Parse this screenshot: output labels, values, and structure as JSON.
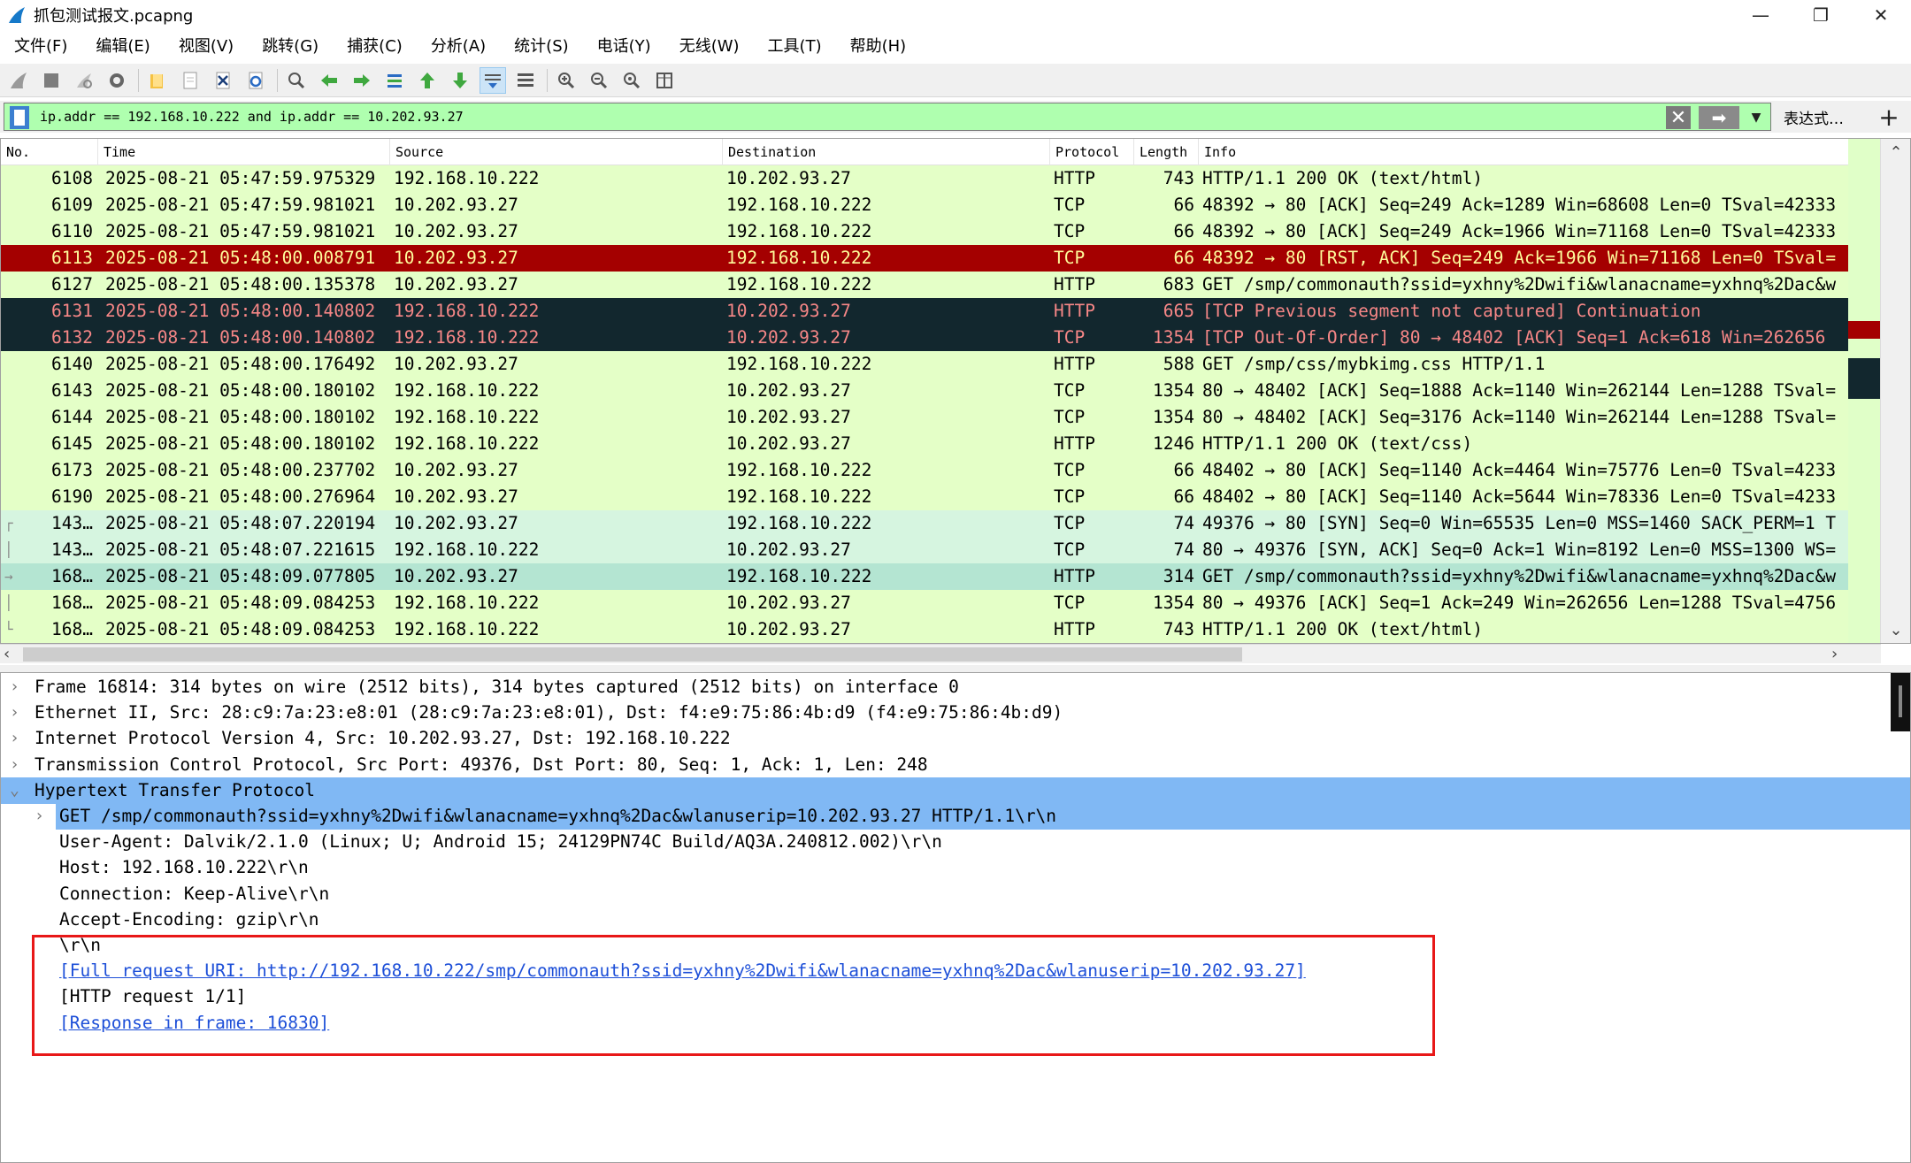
{
  "window": {
    "title": "抓包测试报文.pcapng",
    "min": "—",
    "restore": "❐",
    "close": "✕"
  },
  "menu": [
    "文件(F)",
    "编辑(E)",
    "视图(V)",
    "跳转(G)",
    "捕获(C)",
    "分析(A)",
    "统计(S)",
    "电话(Y)",
    "无线(W)",
    "工具(T)",
    "帮助(H)"
  ],
  "toolbar": {
    "icons": [
      "shark-fin-start-icon",
      "stop-icon",
      "restart-icon",
      "options-gear-icon",
      "open-folder-icon",
      "file-icon",
      "close-file-icon",
      "reload-icon",
      "find-icon",
      "back-arrow-icon",
      "forward-arrow-icon",
      "goto-packet-icon",
      "first-packet-icon",
      "last-packet-icon",
      "autoscroll-icon",
      "colorize-icon",
      "zoom-in-icon",
      "zoom-out-icon",
      "normal-size-icon",
      "resize-columns-icon"
    ]
  },
  "filter": {
    "value": "ip.addr == 192.168.10.222 and ip.addr == 10.202.93.27",
    "clear": "✕",
    "apply": "➡",
    "dropdown": "▼",
    "expression_label": "表达式…",
    "add": "+"
  },
  "packet_list": {
    "columns": [
      "No.",
      "Time",
      "Source",
      "Destination",
      "Protocol",
      "Length",
      "Info"
    ],
    "rows": [
      {
        "no": "6108",
        "time": "2025-08-21 05:47:59.975329",
        "src": "192.168.10.222",
        "dst": "10.202.93.27",
        "proto": "HTTP",
        "len": "743",
        "info": "HTTP/1.1 200 OK  (text/html)",
        "style": "normal",
        "mark": ""
      },
      {
        "no": "6109",
        "time": "2025-08-21 05:47:59.981021",
        "src": "10.202.93.27",
        "dst": "192.168.10.222",
        "proto": "TCP",
        "len": "66",
        "info": "48392 → 80 [ACK] Seq=249 Ack=1289 Win=68608 Len=0 TSval=42333",
        "style": "normal",
        "mark": ""
      },
      {
        "no": "6110",
        "time": "2025-08-21 05:47:59.981021",
        "src": "10.202.93.27",
        "dst": "192.168.10.222",
        "proto": "TCP",
        "len": "66",
        "info": "48392 → 80 [ACK] Seq=249 Ack=1966 Win=71168 Len=0 TSval=42333",
        "style": "normal",
        "mark": ""
      },
      {
        "no": "6113",
        "time": "2025-08-21 05:48:00.008791",
        "src": "10.202.93.27",
        "dst": "192.168.10.222",
        "proto": "TCP",
        "len": "66",
        "info": "48392 → 80 [RST, ACK] Seq=249 Ack=1966 Win=71168 Len=0 TSval=",
        "style": "rst",
        "mark": ""
      },
      {
        "no": "6127",
        "time": "2025-08-21 05:48:00.135378",
        "src": "10.202.93.27",
        "dst": "192.168.10.222",
        "proto": "HTTP",
        "len": "683",
        "info": "GET /smp/commonauth?ssid=yxhny%2Dwifi&wlanacname=yxhnq%2Dac&w",
        "style": "normal",
        "mark": ""
      },
      {
        "no": "6131",
        "time": "2025-08-21 05:48:00.140802",
        "src": "192.168.10.222",
        "dst": "10.202.93.27",
        "proto": "HTTP",
        "len": "665",
        "info": "[TCP Previous segment not captured] Continuation",
        "style": "bad",
        "mark": ""
      },
      {
        "no": "6132",
        "time": "2025-08-21 05:48:00.140802",
        "src": "192.168.10.222",
        "dst": "10.202.93.27",
        "proto": "TCP",
        "len": "1354",
        "info": "[TCP Out-Of-Order] 80 → 48402 [ACK] Seq=1 Ack=618 Win=262656",
        "style": "bad",
        "mark": ""
      },
      {
        "no": "6140",
        "time": "2025-08-21 05:48:00.176492",
        "src": "10.202.93.27",
        "dst": "192.168.10.222",
        "proto": "HTTP",
        "len": "588",
        "info": "GET /smp/css/mybkimg.css HTTP/1.1",
        "style": "normal",
        "mark": ""
      },
      {
        "no": "6143",
        "time": "2025-08-21 05:48:00.180102",
        "src": "192.168.10.222",
        "dst": "10.202.93.27",
        "proto": "TCP",
        "len": "1354",
        "info": "80 → 48402 [ACK] Seq=1888 Ack=1140 Win=262144 Len=1288 TSval=",
        "style": "normal",
        "mark": ""
      },
      {
        "no": "6144",
        "time": "2025-08-21 05:48:00.180102",
        "src": "192.168.10.222",
        "dst": "10.202.93.27",
        "proto": "TCP",
        "len": "1354",
        "info": "80 → 48402 [ACK] Seq=3176 Ack=1140 Win=262144 Len=1288 TSval=",
        "style": "normal",
        "mark": ""
      },
      {
        "no": "6145",
        "time": "2025-08-21 05:48:00.180102",
        "src": "192.168.10.222",
        "dst": "10.202.93.27",
        "proto": "HTTP",
        "len": "1246",
        "info": "HTTP/1.1 200 OK  (text/css)",
        "style": "normal",
        "mark": ""
      },
      {
        "no": "6173",
        "time": "2025-08-21 05:48:00.237702",
        "src": "10.202.93.27",
        "dst": "192.168.10.222",
        "proto": "TCP",
        "len": "66",
        "info": "48402 → 80 [ACK] Seq=1140 Ack=4464 Win=75776 Len=0 TSval=4233",
        "style": "normal",
        "mark": ""
      },
      {
        "no": "6190",
        "time": "2025-08-21 05:48:00.276964",
        "src": "10.202.93.27",
        "dst": "192.168.10.222",
        "proto": "TCP",
        "len": "66",
        "info": "48402 → 80 [ACK] Seq=1140 Ack=5644 Win=78336 Len=0 TSval=4233",
        "style": "normal",
        "mark": ""
      },
      {
        "no": "143…",
        "time": "2025-08-21 05:48:07.220194",
        "src": "10.202.93.27",
        "dst": "192.168.10.222",
        "proto": "TCP",
        "len": "74",
        "info": "49376 → 80 [SYN] Seq=0 Win=65535 Len=0 MSS=1460 SACK_PERM=1 T",
        "style": "syn",
        "mark": "┌"
      },
      {
        "no": "143…",
        "time": "2025-08-21 05:48:07.221615",
        "src": "192.168.10.222",
        "dst": "10.202.93.27",
        "proto": "TCP",
        "len": "74",
        "info": "80 → 49376 [SYN, ACK] Seq=0 Ack=1 Win=8192 Len=0 MSS=1300 WS=",
        "style": "syn",
        "mark": "│"
      },
      {
        "no": "168…",
        "time": "2025-08-21 05:48:09.077805",
        "src": "10.202.93.27",
        "dst": "192.168.10.222",
        "proto": "HTTP",
        "len": "314",
        "info": "GET /smp/commonauth?ssid=yxhny%2Dwifi&wlanacname=yxhnq%2Dac&w",
        "style": "selected",
        "mark": "→"
      },
      {
        "no": "168…",
        "time": "2025-08-21 05:48:09.084253",
        "src": "192.168.10.222",
        "dst": "10.202.93.27",
        "proto": "TCP",
        "len": "1354",
        "info": "80 → 49376 [ACK] Seq=1 Ack=249 Win=262656 Len=1288 TSval=4756",
        "style": "normal",
        "mark": "│"
      },
      {
        "no": "168…",
        "time": "2025-08-21 05:48:09.084253",
        "src": "192.168.10.222",
        "dst": "10.202.93.27",
        "proto": "HTTP",
        "len": "743",
        "info": "HTTP/1.1 200 OK  (text/html)",
        "style": "normal",
        "mark": "└"
      }
    ]
  },
  "details": {
    "rows": [
      {
        "arrow": "›",
        "text": "Frame 16814: 314 bytes on wire (2512 bits), 314 bytes captured (2512 bits) on interface 0",
        "indent": 0,
        "style": "normal"
      },
      {
        "arrow": "›",
        "text": "Ethernet II, Src: 28:c9:7a:23:e8:01 (28:c9:7a:23:e8:01), Dst: f4:e9:75:86:4b:d9 (f4:e9:75:86:4b:d9)",
        "indent": 0,
        "style": "normal"
      },
      {
        "arrow": "›",
        "text": "Internet Protocol Version 4, Src: 10.202.93.27, Dst: 192.168.10.222",
        "indent": 0,
        "style": "normal"
      },
      {
        "arrow": "›",
        "text": "Transmission Control Protocol, Src Port: 49376, Dst Port: 80, Seq: 1, Ack: 1, Len: 248",
        "indent": 0,
        "style": "normal"
      },
      {
        "arrow": "⌄",
        "text": "Hypertext Transfer Protocol",
        "indent": 0,
        "style": "sel"
      },
      {
        "arrow": "›",
        "text": "GET /smp/commonauth?ssid=yxhny%2Dwifi&wlanacname=yxhnq%2Dac&wlanuserip=10.202.93.27 HTTP/1.1\\r\\n",
        "indent": 1,
        "style": "sel"
      },
      {
        "arrow": "",
        "text": "User-Agent: Dalvik/2.1.0 (Linux; U; Android 15; 24129PN74C Build/AQ3A.240812.002)\\r\\n",
        "indent": 1,
        "style": "normal"
      },
      {
        "arrow": "",
        "text": "Host: 192.168.10.222\\r\\n",
        "indent": 1,
        "style": "normal"
      },
      {
        "arrow": "",
        "text": "Connection: Keep-Alive\\r\\n",
        "indent": 1,
        "style": "normal"
      },
      {
        "arrow": "",
        "text": "Accept-Encoding: gzip\\r\\n",
        "indent": 1,
        "style": "normal"
      },
      {
        "arrow": "",
        "text": "\\r\\n",
        "indent": 1,
        "style": "normal"
      },
      {
        "arrow": "",
        "text": "[Full request URI: http://192.168.10.222/smp/commonauth?ssid=yxhny%2Dwifi&wlanacname=yxhnq%2Dac&wlanuserip=10.202.93.27]",
        "indent": 1,
        "style": "link"
      },
      {
        "arrow": "",
        "text": "[HTTP request 1/1]",
        "indent": 1,
        "style": "normal"
      },
      {
        "arrow": "",
        "text": "[Response in frame: 16830]",
        "indent": 1,
        "style": "link"
      }
    ]
  },
  "colors": {
    "row_normal_bg": "#e4ffc7",
    "row_syn_bg": "#d6f5e0",
    "row_selected_bg": "#b4e5d2",
    "row_rst_bg": "#a40000",
    "row_rst_fg": "#fffc9c",
    "row_bad_bg": "#12272e",
    "row_bad_fg": "#f78787",
    "filter_bg": "#afffaf",
    "detail_sel_bg": "#80b8f4",
    "highlight_box": "#e81818"
  }
}
